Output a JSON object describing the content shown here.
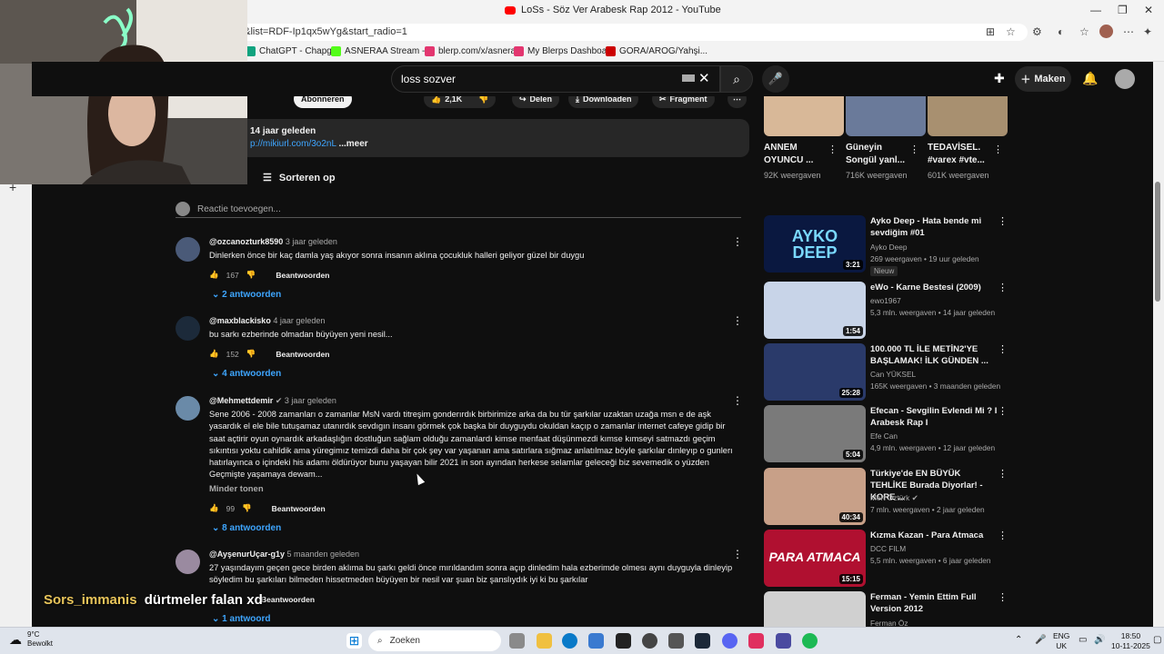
{
  "browser": {
    "window_title": "LoSs - Söz Ver Arabesk Rap 2012 - YouTube",
    "url": "g&list=RDF-Ip1qx5wYg&start_radio=1",
    "bookmarks": [
      {
        "label": "ChatGPT - Chapgpt",
        "color": "#10a37f"
      },
      {
        "label": "ASNERAA Stream -...",
        "color": "#53fc18"
      },
      {
        "label": "blerp.com/x/asneraa",
        "color": "#e3366f"
      },
      {
        "label": "My Blerps Dashboard",
        "color": "#e3366f"
      },
      {
        "label": "GORA/AROG/Yahşi...",
        "color": "#c00"
      }
    ]
  },
  "youtube": {
    "search_query": "loss sozver",
    "create_label": "Maken",
    "actions": {
      "subscribe": "Abonneren",
      "likes": "2,1K",
      "share": "Delen",
      "download": "Downloaden",
      "clip": "Fragment"
    },
    "description": {
      "age": "14 jaar geleden",
      "link": "p://mikiurl.com/3o2nL",
      "more": "...meer"
    },
    "sort_label": "Sorteren op",
    "add_comment_placeholder": "Reactie toevoegen...",
    "comments": [
      {
        "author": "@ozcanozturk8590",
        "time": "3 jaar geleden",
        "text": "Dinlerken önce bir kaç damla yaş akıyor sonra insanın aklına çocukluk halleri geliyor güzel bir duygu",
        "likes": "167",
        "reply_label": "Beantwoorden",
        "replies": "2 antwoorden",
        "avatar_color": "#4a5a78"
      },
      {
        "author": "@maxblackisko",
        "time": "4 jaar geleden",
        "text": "bu sarkı ezberinde olmadan büyüyen yeni nesil...",
        "likes": "152",
        "reply_label": "Beantwoorden",
        "replies": "4 antwoorden",
        "avatar_color": "#1c2a3a"
      },
      {
        "author": "@Mehmettdemir",
        "verified": "✔",
        "time": "3 jaar geleden",
        "text": "Sene 2006 - 2008 zamanları o zamanlar MsN vardı titreşim gonderırdık birbirimize arka da bu tür şarkılar uzaktan uzağa msn e de aşk yasardık el ele bile tutuşamaz utanırdık sevdıgın insanı görmek çok başka bir duyguydu okuldan kaçıp o zamanlar internet cafeye gidip bir saat açtirir oyun oynardık arkadaşlığın dostluğun sağlam olduğu zamanlardı kimse menfaat düşünmezdi kımse kımseyi satmazdı geçim sıkıntısı yoktu cahildik ama yüregimız temizdi daha bir çok şey var yaşanan ama satırlara sığmaz anlatılmaz böyle şarkılar dınleyıp o gunlerı hatırlayınca o içindeki his adamı öldürüyor bunu yaşayan bilir 2021 in son ayından herkese selamlar geleceği biz sevemedik o yüzden Geçmişte yaşamaya dewam...",
        "show_less": "Minder tonen",
        "likes": "99",
        "reply_label": "Beantwoorden",
        "replies": "8 antwoorden",
        "avatar_color": "#6a8aa8"
      },
      {
        "author": "@AyşenurUçar-g1y",
        "time": "5 maanden geleden",
        "text": "27 yaşındayım geçen gece birden aklıma bu şarkı geldi önce mırıldandım sonra açıp dinledim hala ezberimde olmesı aynı duyguyla dinleyip söyledim bu şarkıları bilmeden hissetmeden büyüyen bir nesil var şuan biz şanslıydık iyi ki bu şarkılar",
        "reply_label": "Beantwoorden",
        "replies": "1 antwoord",
        "avatar_color": "#9a8aa0"
      }
    ],
    "shorts": [
      {
        "title": "ANNEM OYUNCU ...",
        "views": "92K weergaven",
        "color": "#d8b898"
      },
      {
        "title": "Güneyin Songül yanl...",
        "views": "716K weergaven",
        "color": "#6a7a9a"
      },
      {
        "title": "TEDAVİSEL. #varex #vte...",
        "views": "601K weergaven",
        "color": "#a89070"
      }
    ],
    "recommended": [
      {
        "title": "Ayko Deep - Hata bende mi sevdiğim #01",
        "channel": "Ayko Deep",
        "meta": "269 weergaven • 19 uur geleden",
        "badge": "Nieuw",
        "duration": "3:21",
        "thumb_text": "AYKO DEEP",
        "thumb_color": "#0a1840"
      },
      {
        "title": "eWo - Karne Bestesi (2009)",
        "channel": "ewo1967",
        "meta": "5,3 mln. weergaven • 14 jaar geleden",
        "duration": "1:54",
        "thumb_text": "",
        "thumb_color": "#c8d4e8"
      },
      {
        "title": "100.000 TL İLE METİN2'YE BAŞLAMAK! İLK GÜNDEN ...",
        "channel": "Can YÜKSEL",
        "meta": "165K weergaven • 3 maanden geleden",
        "duration": "25:28",
        "thumb_text": "",
        "thumb_color": "#2a3a6a"
      },
      {
        "title": "Efecan - Sevgilin Evlendi Mi ? I Arabesk Rap I",
        "channel": "Efe Can",
        "meta": "4,9 mln. weergaven • 12 jaar geleden",
        "duration": "5:04",
        "thumb_text": "",
        "thumb_color": "#7a7a7a"
      },
      {
        "title": "Türkiye'de EN BÜYÜK TEHLİKE Burada Diyorlar! - KORE ...",
        "channel": "Mert Öztürk",
        "verified": "✔",
        "meta": "7 mln. weergaven • 2 jaar geleden",
        "duration": "40:34",
        "thumb_text": "",
        "thumb_color": "#c8a088"
      },
      {
        "title": "Kızma Kazan - Para Atmaca",
        "channel": "DCC FILM",
        "meta": "5,5 mln. weergaven • 6 jaar geleden",
        "duration": "15:15",
        "thumb_text": "PARA ATMACA",
        "thumb_color": "#b01030"
      },
      {
        "title": "Ferman - Yemin Ettim Full Version 2012",
        "channel": "Ferman Öz",
        "meta": "",
        "duration": "",
        "thumb_text": "",
        "thumb_color": "#d0d0d0"
      }
    ]
  },
  "stream_overlay": {
    "user": "Sors_immanis",
    "message": "dürtmeler falan xd"
  },
  "taskbar": {
    "temp": "9°C",
    "weather": "Bewolkt",
    "search_label": "Zoeken",
    "lang1": "ENG",
    "lang2": "UK",
    "time": "18:50",
    "date": "10-11-2025"
  }
}
